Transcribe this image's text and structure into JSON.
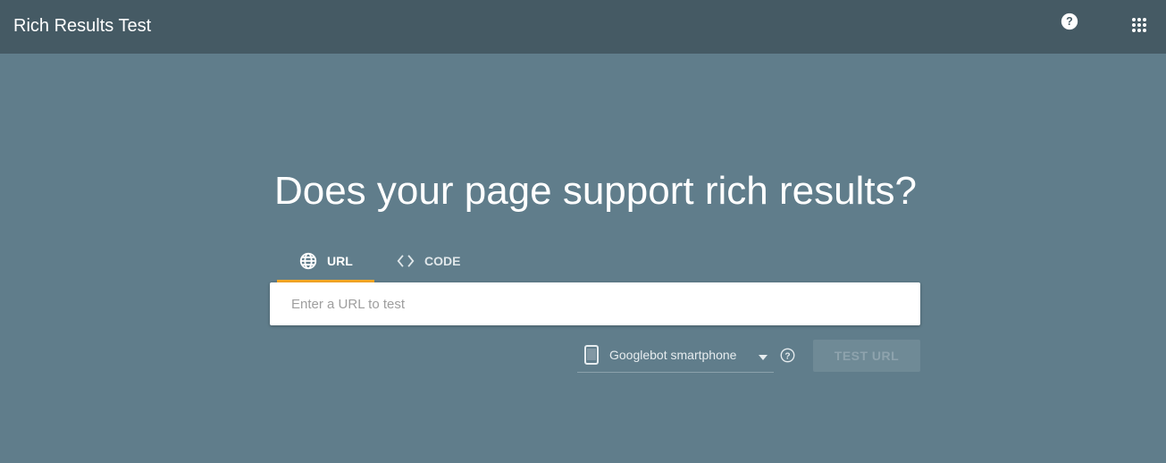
{
  "app": {
    "title": "Rich Results Test",
    "header_icons": [
      "help-icon",
      "apps-icon"
    ]
  },
  "main": {
    "headline": "Does your page support rich results?",
    "tabs": [
      {
        "label": "URL",
        "icon": "globe-icon",
        "selected": true
      },
      {
        "label": "CODE",
        "icon": "code-icon",
        "selected": false
      }
    ],
    "url_input": {
      "value": "",
      "placeholder": "Enter a URL to test"
    },
    "user_agent": {
      "icon": "smartphone-icon",
      "selected": "Googlebot smartphone"
    },
    "test_button": {
      "label": "TEST URL",
      "enabled": false
    }
  },
  "colors": {
    "header_bg": "#455a64",
    "page_bg": "#607d8b",
    "tab_indicator": "#f9a825"
  }
}
